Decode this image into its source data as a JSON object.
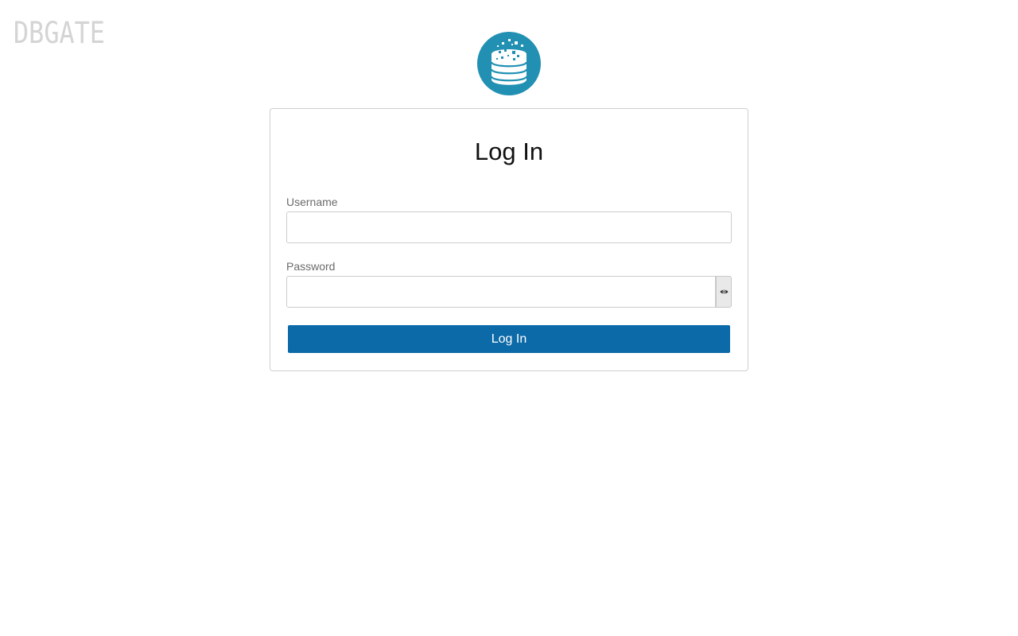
{
  "app": {
    "brand_name": "DBGATE",
    "logo_icon": "database-stack-icon",
    "logo_color": "#2190b3"
  },
  "login": {
    "title": "Log In",
    "username_label": "Username",
    "username_value": "",
    "password_label": "Password",
    "password_value": "",
    "toggle_password_icon": "eye-icon",
    "submit_label": "Log In",
    "accent_color": "#0d6aa8"
  }
}
